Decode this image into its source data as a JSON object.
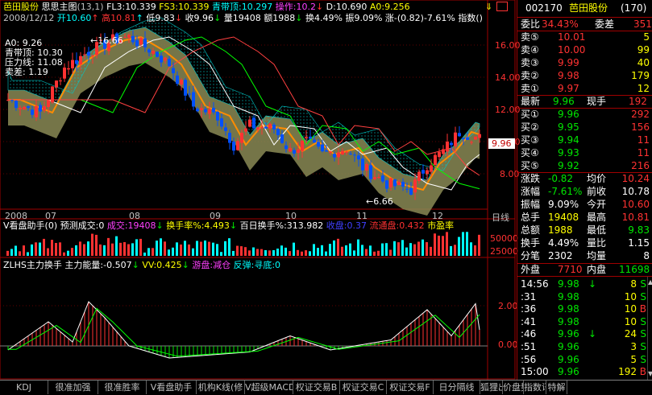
{
  "header": {
    "stock_name": "芭田股份",
    "chart_name": "思思主图",
    "params": "(13,1)",
    "fl3_label": "FL3:10.339",
    "fs3_label": "FS3:10.339",
    "band_label": "青带顶:10.297",
    "op_label": "操作:10.2",
    "d_label": "D:10.690",
    "a0_label": "A0:9.256",
    "date": "2008/12/12",
    "open_label": "开10.60",
    "high_label": "高10.81",
    "low_label": "低9.83",
    "close_label": "收9.96",
    "vol_label": "量19408",
    "amt_label": "额1988",
    "turn_label": "换4.49%",
    "amp_label": "振9.09%",
    "chg_label": "涨-(0.82)-7.61%",
    "index_label": "指数()"
  },
  "overlay_labels": {
    "a0": "A0: 9.26",
    "band_top": "青带顶: 10.30",
    "pressure": "压力线: 11.08",
    "sell": "卖差: 1.19",
    "peak": "16.66",
    "trough": "6.66",
    "last_price": "9.96"
  },
  "main_axis_ticks": [
    "16.00",
    "14.00",
    "12.00",
    "10.00",
    "8.00"
  ],
  "date_axis": [
    "2008",
    "07",
    "08",
    "09",
    "10",
    "11",
    "12",
    "日线"
  ],
  "vol_panel": {
    "title": "V看盘助手(0)",
    "pred": "预测成交:0",
    "vol": "成交:19408",
    "turn_rate": "换手率%:4.493",
    "hundred": "百日换手%:313.982",
    "close_disk": "收盘:0.37",
    "float": "流通盘:0.432",
    "pe": "市盈率",
    "tick1": "50000",
    "tick2": "25000"
  },
  "ind_panel": {
    "title": "ZLHS主力换手",
    "energy": "主力能量:-0.507",
    "vv": "VV:0.425",
    "flow": "游盘:减仓",
    "rebound": "反弹:寻底:0",
    "tick1": "2.00",
    "tick2": "0.00"
  },
  "quote": {
    "code": "002170",
    "name": "芭田股份",
    "badge": "(170)",
    "weibi_label": "委比",
    "weibi_value": "34.43%",
    "weicha_label": "委差",
    "weicha_value": "351",
    "sells": [
      {
        "label": "卖⑤",
        "price": "10.01",
        "vol": "5"
      },
      {
        "label": "卖④",
        "price": "10.00",
        "vol": "99"
      },
      {
        "label": "卖③",
        "price": "9.99",
        "vol": "40"
      },
      {
        "label": "卖②",
        "price": "9.98",
        "vol": "179"
      },
      {
        "label": "卖①",
        "price": "9.97",
        "vol": "12"
      }
    ],
    "last_label": "最新",
    "last_value": "9.96",
    "now_label": "现手",
    "now_value": "192",
    "buys": [
      {
        "label": "买①",
        "price": "9.96",
        "vol": "292"
      },
      {
        "label": "买②",
        "price": "9.95",
        "vol": "156"
      },
      {
        "label": "买③",
        "price": "9.94",
        "vol": "11"
      },
      {
        "label": "买④",
        "price": "9.93",
        "vol": "11"
      },
      {
        "label": "买⑤",
        "price": "9.92",
        "vol": "216"
      }
    ],
    "stats": [
      {
        "l1": "涨跌",
        "v1": "-0.82",
        "l2": "均价",
        "v2": "10.24"
      },
      {
        "l1": "涨幅",
        "v1": "-7.61%",
        "l2": "前收",
        "v2": "10.78"
      },
      {
        "l1": "振幅",
        "v1": "9.09%",
        "l2": "今开",
        "v2": "10.60"
      },
      {
        "l1": "总手",
        "v1": "19408",
        "l2": "最高",
        "v2": "10.81"
      },
      {
        "l1": "总额",
        "v1": "1988",
        "l2": "最低",
        "v2": "9.83"
      },
      {
        "l1": "换手",
        "v1": "4.49%",
        "l2": "量比",
        "v2": "1.15"
      },
      {
        "l1": "分笔",
        "v1": "2302",
        "l2": "均量",
        "v2": "8"
      }
    ],
    "outer_label": "外盘",
    "outer_value": "7710",
    "inner_label": "内盘",
    "inner_value": "11698",
    "ticks": [
      {
        "time": "14:56",
        "price": "9.98",
        "arrow": "↓",
        "vol": "8",
        "side": "S"
      },
      {
        "time": ":31",
        "price": "9.98",
        "arrow": "",
        "vol": "10",
        "side": "S"
      },
      {
        "time": ":36",
        "price": "9.98",
        "arrow": "",
        "vol": "10",
        "side": "B"
      },
      {
        "time": ":41",
        "price": "9.98",
        "arrow": "",
        "vol": "10",
        "side": "S"
      },
      {
        "time": ":46",
        "price": "9.96",
        "arrow": "↓",
        "vol": "24",
        "side": "S"
      },
      {
        "time": ":51",
        "price": "9.96",
        "arrow": "",
        "vol": "3",
        "side": "S"
      },
      {
        "time": ":56",
        "price": "9.96",
        "arrow": "",
        "vol": "5",
        "side": "S"
      },
      {
        "time": "15:00",
        "price": "9.96",
        "arrow": "",
        "vol": "192",
        "side": "B"
      }
    ]
  },
  "tabs": [
    "KDJ",
    "很准加强",
    "很准胜率",
    "V看盘助手",
    "机构K线(修",
    "V超级MACD",
    "权证交易B",
    "权证交易C",
    "权证交易F",
    "日分隔线",
    "狐狸出击",
    "价盘势周",
    "指数讯成",
    "特解"
  ]
}
